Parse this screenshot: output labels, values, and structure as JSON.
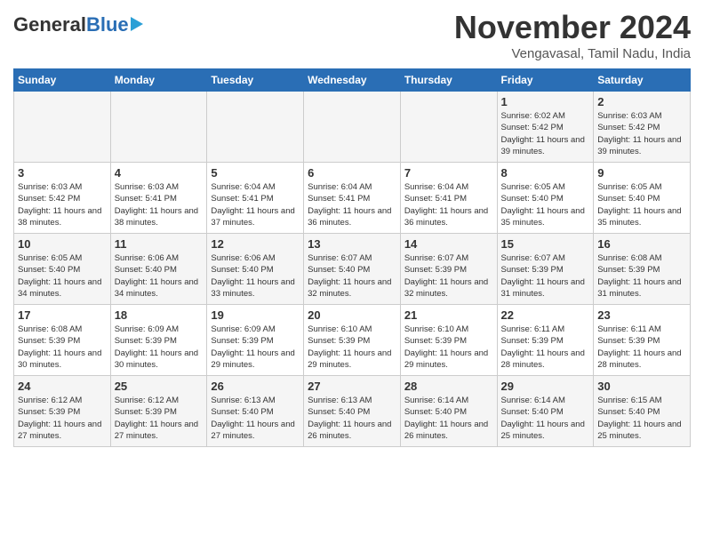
{
  "logo": {
    "general": "General",
    "blue": "Blue"
  },
  "title": "November 2024",
  "location": "Vengavasal, Tamil Nadu, India",
  "days_header": [
    "Sunday",
    "Monday",
    "Tuesday",
    "Wednesday",
    "Thursday",
    "Friday",
    "Saturday"
  ],
  "weeks": [
    [
      {
        "day": "",
        "info": ""
      },
      {
        "day": "",
        "info": ""
      },
      {
        "day": "",
        "info": ""
      },
      {
        "day": "",
        "info": ""
      },
      {
        "day": "",
        "info": ""
      },
      {
        "day": "1",
        "info": "Sunrise: 6:02 AM\nSunset: 5:42 PM\nDaylight: 11 hours and 39 minutes."
      },
      {
        "day": "2",
        "info": "Sunrise: 6:03 AM\nSunset: 5:42 PM\nDaylight: 11 hours and 39 minutes."
      }
    ],
    [
      {
        "day": "3",
        "info": "Sunrise: 6:03 AM\nSunset: 5:42 PM\nDaylight: 11 hours and 38 minutes."
      },
      {
        "day": "4",
        "info": "Sunrise: 6:03 AM\nSunset: 5:41 PM\nDaylight: 11 hours and 38 minutes."
      },
      {
        "day": "5",
        "info": "Sunrise: 6:04 AM\nSunset: 5:41 PM\nDaylight: 11 hours and 37 minutes."
      },
      {
        "day": "6",
        "info": "Sunrise: 6:04 AM\nSunset: 5:41 PM\nDaylight: 11 hours and 36 minutes."
      },
      {
        "day": "7",
        "info": "Sunrise: 6:04 AM\nSunset: 5:41 PM\nDaylight: 11 hours and 36 minutes."
      },
      {
        "day": "8",
        "info": "Sunrise: 6:05 AM\nSunset: 5:40 PM\nDaylight: 11 hours and 35 minutes."
      },
      {
        "day": "9",
        "info": "Sunrise: 6:05 AM\nSunset: 5:40 PM\nDaylight: 11 hours and 35 minutes."
      }
    ],
    [
      {
        "day": "10",
        "info": "Sunrise: 6:05 AM\nSunset: 5:40 PM\nDaylight: 11 hours and 34 minutes."
      },
      {
        "day": "11",
        "info": "Sunrise: 6:06 AM\nSunset: 5:40 PM\nDaylight: 11 hours and 34 minutes."
      },
      {
        "day": "12",
        "info": "Sunrise: 6:06 AM\nSunset: 5:40 PM\nDaylight: 11 hours and 33 minutes."
      },
      {
        "day": "13",
        "info": "Sunrise: 6:07 AM\nSunset: 5:40 PM\nDaylight: 11 hours and 32 minutes."
      },
      {
        "day": "14",
        "info": "Sunrise: 6:07 AM\nSunset: 5:39 PM\nDaylight: 11 hours and 32 minutes."
      },
      {
        "day": "15",
        "info": "Sunrise: 6:07 AM\nSunset: 5:39 PM\nDaylight: 11 hours and 31 minutes."
      },
      {
        "day": "16",
        "info": "Sunrise: 6:08 AM\nSunset: 5:39 PM\nDaylight: 11 hours and 31 minutes."
      }
    ],
    [
      {
        "day": "17",
        "info": "Sunrise: 6:08 AM\nSunset: 5:39 PM\nDaylight: 11 hours and 30 minutes."
      },
      {
        "day": "18",
        "info": "Sunrise: 6:09 AM\nSunset: 5:39 PM\nDaylight: 11 hours and 30 minutes."
      },
      {
        "day": "19",
        "info": "Sunrise: 6:09 AM\nSunset: 5:39 PM\nDaylight: 11 hours and 29 minutes."
      },
      {
        "day": "20",
        "info": "Sunrise: 6:10 AM\nSunset: 5:39 PM\nDaylight: 11 hours and 29 minutes."
      },
      {
        "day": "21",
        "info": "Sunrise: 6:10 AM\nSunset: 5:39 PM\nDaylight: 11 hours and 29 minutes."
      },
      {
        "day": "22",
        "info": "Sunrise: 6:11 AM\nSunset: 5:39 PM\nDaylight: 11 hours and 28 minutes."
      },
      {
        "day": "23",
        "info": "Sunrise: 6:11 AM\nSunset: 5:39 PM\nDaylight: 11 hours and 28 minutes."
      }
    ],
    [
      {
        "day": "24",
        "info": "Sunrise: 6:12 AM\nSunset: 5:39 PM\nDaylight: 11 hours and 27 minutes."
      },
      {
        "day": "25",
        "info": "Sunrise: 6:12 AM\nSunset: 5:39 PM\nDaylight: 11 hours and 27 minutes."
      },
      {
        "day": "26",
        "info": "Sunrise: 6:13 AM\nSunset: 5:40 PM\nDaylight: 11 hours and 27 minutes."
      },
      {
        "day": "27",
        "info": "Sunrise: 6:13 AM\nSunset: 5:40 PM\nDaylight: 11 hours and 26 minutes."
      },
      {
        "day": "28",
        "info": "Sunrise: 6:14 AM\nSunset: 5:40 PM\nDaylight: 11 hours and 26 minutes."
      },
      {
        "day": "29",
        "info": "Sunrise: 6:14 AM\nSunset: 5:40 PM\nDaylight: 11 hours and 25 minutes."
      },
      {
        "day": "30",
        "info": "Sunrise: 6:15 AM\nSunset: 5:40 PM\nDaylight: 11 hours and 25 minutes."
      }
    ]
  ]
}
